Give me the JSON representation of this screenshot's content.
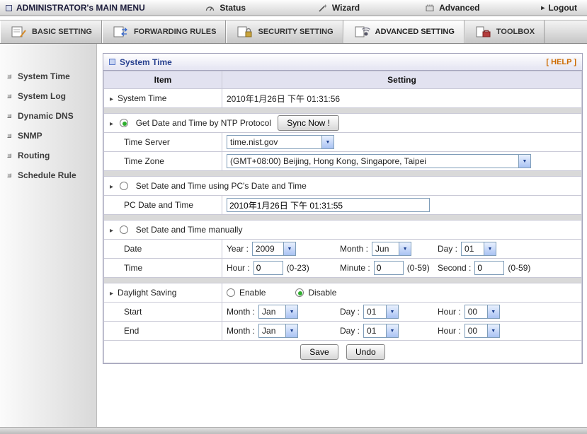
{
  "topbar": {
    "title": "ADMINISTRATOR's MAIN MENU",
    "status": "Status",
    "wizard": "Wizard",
    "advanced": "Advanced",
    "logout": "Logout"
  },
  "tabs": {
    "basic": "BASIC SETTING",
    "forwarding": "FORWARDING RULES",
    "security": "SECURITY SETTING",
    "advanced": "ADVANCED SETTING",
    "toolbox": "TOOLBOX",
    "active_tab": "ADVANCED SETTING"
  },
  "sidebar": {
    "items": [
      "System Time",
      "System Log",
      "Dynamic DNS",
      "SNMP",
      "Routing",
      "Schedule Rule"
    ],
    "active_item": "System Time"
  },
  "icons": {
    "row_arrow": "▸",
    "dropdown_arrow": "▼",
    "logout_arrow": "▸"
  },
  "panel": {
    "title": "System Time",
    "help_label": "[ HELP ]",
    "header": {
      "item": "Item",
      "setting": "Setting"
    },
    "system_time": {
      "label": "System Time",
      "value": "2010年1月26日 下午 01:31:56"
    },
    "selected_method": "ntp",
    "ntp": {
      "label": "Get Date and Time by NTP Protocol",
      "sync_button": "Sync Now !",
      "time_server": {
        "label": "Time Server",
        "value": "time.nist.gov"
      },
      "time_zone": {
        "label": "Time Zone",
        "value": "(GMT+08:00) Beijing, Hong Kong, Singapore, Taipei"
      }
    },
    "pc": {
      "label": "Set Date and Time using PC's Date and Time",
      "field_label": "PC Date and Time",
      "value": "2010年1月26日 下午 01:31:55"
    },
    "manual": {
      "label": "Set Date and Time manually",
      "date": {
        "label": "Date",
        "year_label": "Year :",
        "year": "2009",
        "month_label": "Month :",
        "month": "Jun",
        "day_label": "Day :",
        "day": "01"
      },
      "time": {
        "label": "Time",
        "hour_label": "Hour :",
        "hour": "0",
        "hour_range": "(0-23)",
        "minute_label": "Minute :",
        "minute": "0",
        "minute_range": "(0-59)",
        "second_label": "Second :",
        "second": "0",
        "second_range": "(0-59)"
      }
    },
    "daylight": {
      "label": "Daylight Saving",
      "enable": "Enable",
      "disable": "Disable",
      "mode": "Disable",
      "start": {
        "label": "Start",
        "month_label": "Month :",
        "month": "Jan",
        "day_label": "Day :",
        "day": "01",
        "hour_label": "Hour :",
        "hour": "00"
      },
      "end": {
        "label": "End",
        "month_label": "Month :",
        "month": "Jan",
        "day_label": "Day :",
        "day": "01",
        "hour_label": "Hour :",
        "hour": "00"
      }
    },
    "buttons": {
      "save": "Save",
      "undo": "Undo"
    }
  },
  "colors": {
    "title_blue": "#27408f",
    "help_orange": "#cc6a00",
    "radio_green": "#2fae2f",
    "table_header": "#e2e2f0"
  }
}
